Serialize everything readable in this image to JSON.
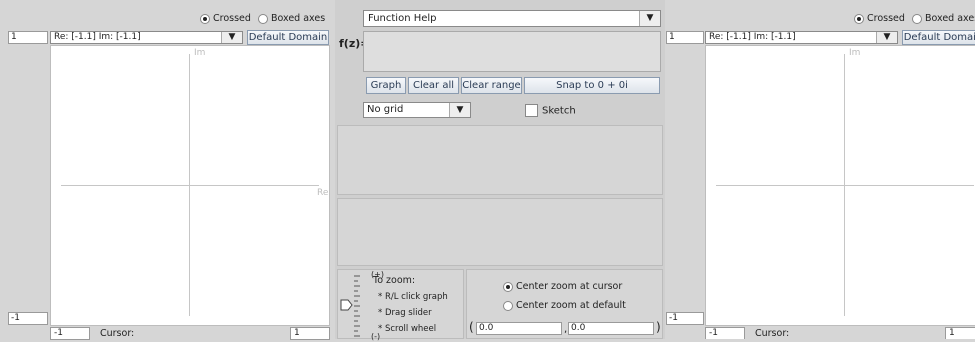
{
  "left_graph": {
    "axes_mode": {
      "crossed_label": "Crossed",
      "boxed_label": "Boxed axes",
      "selected": "crossed"
    },
    "top_value": "1",
    "range_text": "Re: [-1.1]  Im: [-1.1]",
    "domain_button": "Default Domain",
    "im_label": "Im",
    "re_label": "Re",
    "bottom_left_value": "-1",
    "x_min": "-1",
    "cursor_label": "Cursor:",
    "x_max": "1"
  },
  "right_graph": {
    "axes_mode": {
      "crossed_label": "Crossed",
      "boxed_label": "Boxed axes",
      "selected": "crossed"
    },
    "top_value": "1",
    "range_text": "Re: [-1.1]  Im: [-1.1]",
    "domain_button": "Default Domain",
    "im_label": "Im",
    "bottom_left_value": "-1",
    "x_min": "-1",
    "cursor_label": "Cursor:",
    "x_max": "1"
  },
  "center": {
    "function_help": "Function Help",
    "fz_label": "f(z)=",
    "fz_value": "",
    "buttons": {
      "graph": "Graph",
      "clear_all": "Clear all",
      "clear_range": "Clear range",
      "snap": "Snap to 0 + 0i"
    },
    "grid_select": "No grid",
    "sketch_label": "Sketch",
    "zoom": {
      "plus": "(+)",
      "minus": "(-)",
      "title": "To zoom:",
      "hint1": "* R/L click graph",
      "hint2": "* Drag slider",
      "hint3": "* Scroll wheel",
      "center_cursor": "Center zoom at cursor",
      "center_default": "Center zoom at default",
      "center_selected": "cursor",
      "coord_open": "(",
      "re_value": "0.0",
      "comma": ",",
      "im_value": "0.0",
      "coord_close": ")"
    }
  }
}
